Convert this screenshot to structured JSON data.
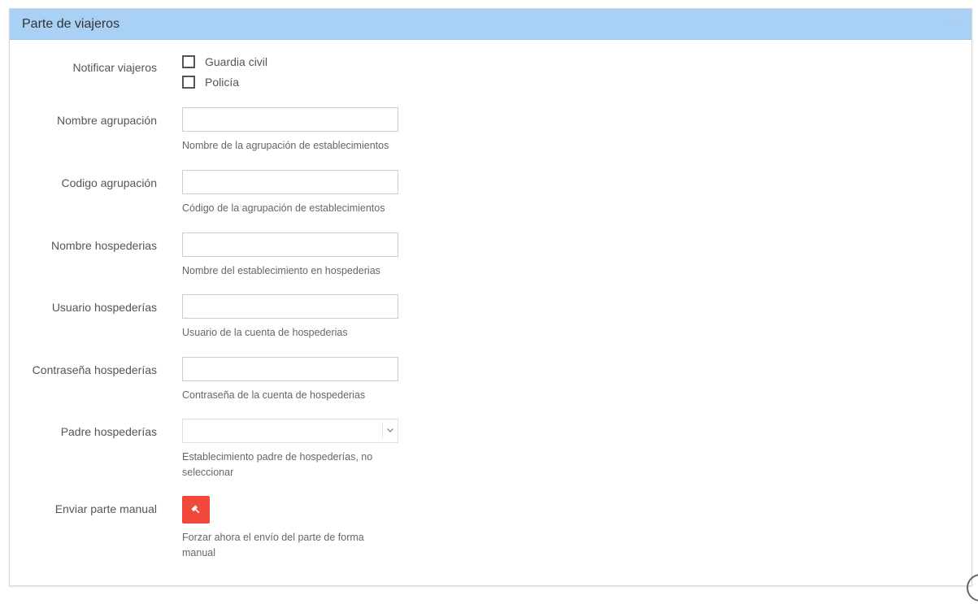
{
  "panel": {
    "title": "Parte de viajeros"
  },
  "notificar": {
    "label": "Notificar viajeros",
    "options": [
      {
        "label": "Guardia civil",
        "checked": false
      },
      {
        "label": "Policía",
        "checked": false
      }
    ]
  },
  "fields": {
    "nombre_agrupacion": {
      "label": "Nombre agrupación",
      "value": "",
      "help": "Nombre de la agrupación de establecimientos"
    },
    "codigo_agrupacion": {
      "label": "Codigo agrupación",
      "value": "",
      "help": "Código de la agrupación de establecimientos"
    },
    "nombre_hospederias": {
      "label": "Nombre hospederias",
      "value": "",
      "help": "Nombre del establecimiento en hospederias"
    },
    "usuario_hospederias": {
      "label": "Usuario hospederías",
      "value": "",
      "help": "Usuario de la cuenta de hospederias"
    },
    "contrasena_hospederias": {
      "label": "Contraseña hospederías",
      "value": "",
      "help": "Contraseña de la cuenta de hospederias"
    },
    "padre_hospederias": {
      "label": "Padre hospederías",
      "selected": "",
      "help_line1": "Establecimiento padre de hospederías, no",
      "help_line2": "seleccionar"
    },
    "enviar_parte": {
      "label": "Enviar parte manual",
      "help_line1": "Forzar ahora el envío del parte de forma",
      "help_line2": "manual"
    }
  },
  "colors": {
    "header_bg": "#a9d0f5",
    "button_bg": "#f0493b"
  },
  "icons": {
    "collapse": "minus-icon",
    "select": "chevron-down-icon",
    "button": "gavel-icon"
  }
}
